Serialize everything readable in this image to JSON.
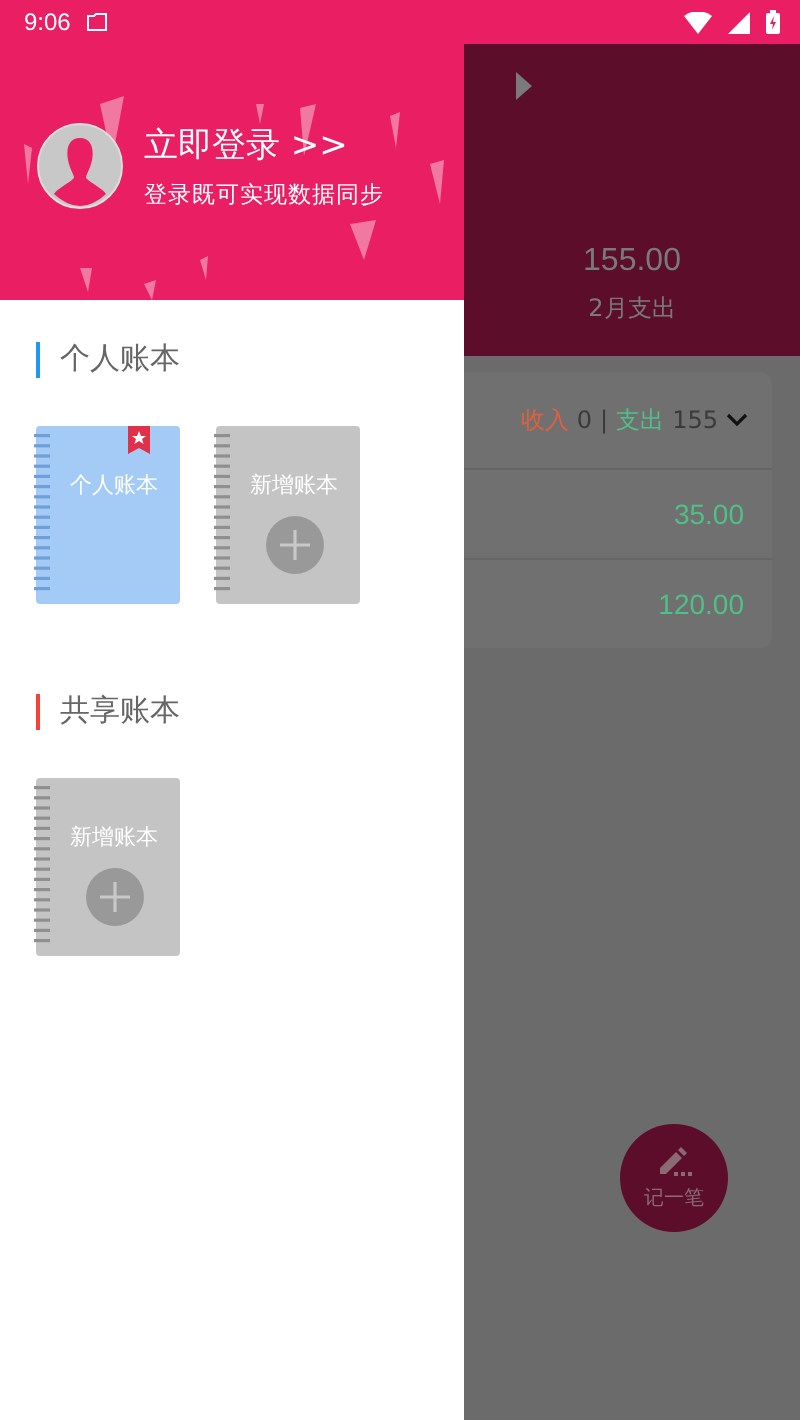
{
  "status_bar": {
    "time": "9:06"
  },
  "drawer": {
    "login": {
      "title": "立即登录 >>",
      "subtitle": "登录既可实现数据同步"
    },
    "sections": [
      {
        "title": "个人账本",
        "color": "#2196f3",
        "books": [
          {
            "kind": "notebook",
            "label": "个人账本",
            "starred": true
          },
          {
            "kind": "add",
            "label": "新增账本"
          }
        ]
      },
      {
        "title": "共享账本",
        "color": "#f44336",
        "books": [
          {
            "kind": "add",
            "label": "新增账本"
          }
        ]
      }
    ]
  },
  "background": {
    "header": {
      "amount": "155.00",
      "label": "2月支出"
    },
    "summary": {
      "income_label": "收入",
      "income": "0",
      "separator": "|",
      "expense_label": "支出",
      "expense": "155"
    },
    "rows": [
      {
        "amount": "35.00"
      },
      {
        "amount": "120.00"
      }
    ],
    "fab": {
      "label": "记一笔"
    }
  }
}
